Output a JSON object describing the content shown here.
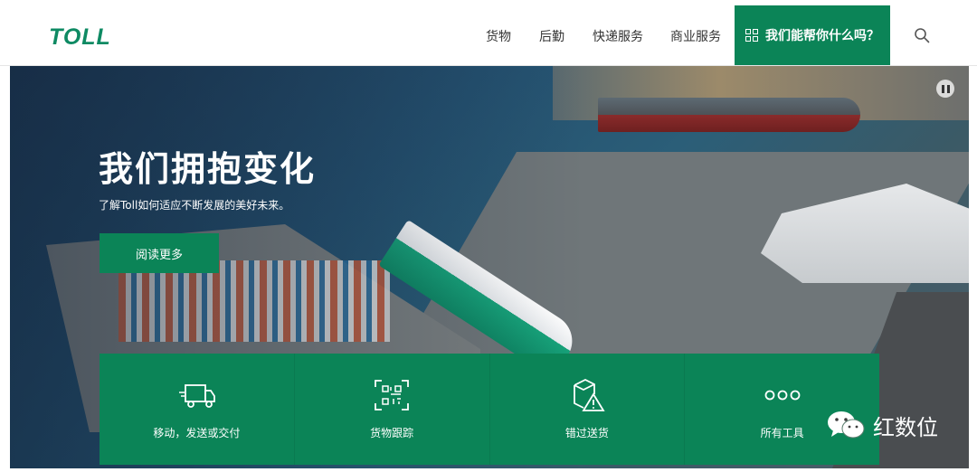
{
  "header": {
    "logo_text": "TOLL",
    "nav": [
      "货物",
      "后勤",
      "快递服务",
      "商业服务"
    ],
    "help_label": "我们能帮你什么吗？"
  },
  "hero": {
    "title": "我们拥抱变化",
    "subtitle": "了解Toll如何适应不断发展的美好未来。",
    "cta_label": "阅读更多"
  },
  "tools": [
    {
      "label": "移动，发送或交付",
      "icon": "truck-icon"
    },
    {
      "label": "货物跟踪",
      "icon": "qr-scan-icon"
    },
    {
      "label": "错过送货",
      "icon": "package-warning-icon"
    },
    {
      "label": "所有工具",
      "icon": "more-dots-icon"
    }
  ],
  "watermark": {
    "text": "红数位",
    "icon": "wechat-icon"
  },
  "colors": {
    "brand_green": "#0b8457",
    "logo_green": "#0e8a63"
  }
}
